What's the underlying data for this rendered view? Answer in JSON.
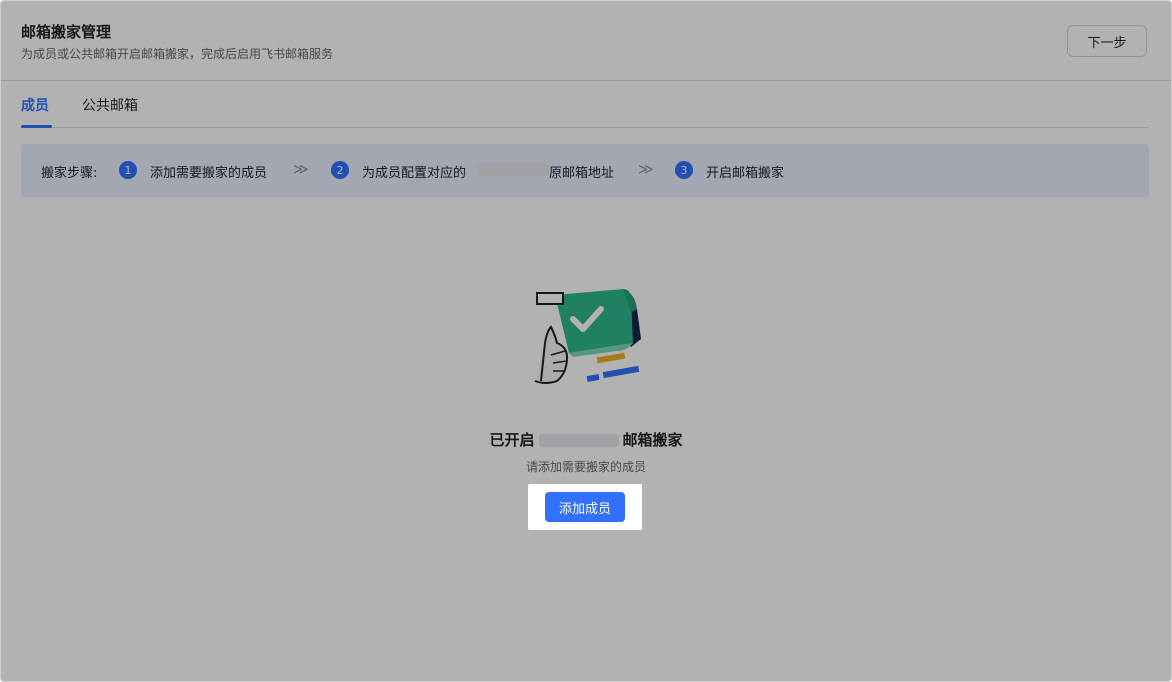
{
  "header": {
    "title": "邮箱搬家管理",
    "subtitle": "为成员或公共邮箱开启邮箱搬家，完成后启用飞书邮箱服务",
    "next_label": "下一步"
  },
  "tabs": [
    {
      "label": "成员",
      "active": true
    },
    {
      "label": "公共邮箱",
      "active": false
    }
  ],
  "steps": {
    "label": "搬家步骤:",
    "items": [
      {
        "num": "1",
        "text": "添加需要搬家的成员"
      },
      {
        "num": "2",
        "text_before": "为成员配置对应的",
        "text_after": "原邮箱地址"
      },
      {
        "num": "3",
        "text": "开启邮箱搬家"
      }
    ],
    "separator": "≫"
  },
  "empty_state": {
    "title_prefix": "已开启",
    "title_suffix": "邮箱搬家",
    "subtitle": "请添加需要搬家的成员",
    "button_label": "添加成员"
  },
  "colors": {
    "accent": "#3370ff",
    "steps_bg": "#e8efff",
    "illustration_green": "#2fb88f"
  }
}
